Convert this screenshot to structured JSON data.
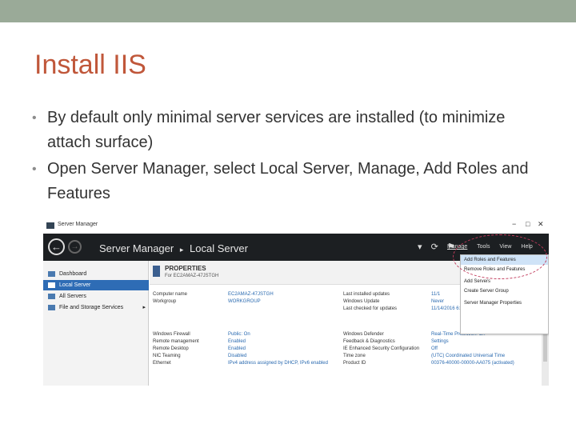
{
  "slide": {
    "title": "Install IIS",
    "bullets": [
      "By default only minimal server services are installed (to minimize attach surface)",
      "Open Server Manager, select Local Server, Manage, Add Roles and Features"
    ],
    "bullet_glyph": "•"
  },
  "screenshot": {
    "window_title": "Server Manager",
    "window_controls": [
      "−",
      "□",
      "✕"
    ],
    "breadcrumb": {
      "root": "Server Manager",
      "separator": "▸",
      "current": "Local Server"
    },
    "menus": [
      "Manage",
      "Tools",
      "View",
      "Help"
    ],
    "sidebar": [
      {
        "label": "Dashboard"
      },
      {
        "label": "Local Server"
      },
      {
        "label": "All Servers"
      },
      {
        "label": "File and Storage Services",
        "chevron": "▸"
      }
    ],
    "properties": {
      "title": "PROPERTIES",
      "subtitle": "For EC2AMAZ-47JSTGH",
      "left_rows": [
        {
          "key": "Computer name",
          "value": "EC2AMAZ-47JSTGH"
        },
        {
          "key": "Workgroup",
          "value": "WORKGROUP"
        },
        {
          "key": "Windows Firewall",
          "value": "Public: On"
        },
        {
          "key": "Remote management",
          "value": "Enabled"
        },
        {
          "key": "Remote Desktop",
          "value": "Enabled"
        },
        {
          "key": "NIC Teaming",
          "value": "Disabled"
        },
        {
          "key": "Ethernet",
          "value": "IPv4 address assigned by DHCP, IPv6 enabled"
        }
      ],
      "right_rows": [
        {
          "key": "Last installed updates",
          "value": "11/1"
        },
        {
          "key": "Windows Update",
          "value": "Never"
        },
        {
          "key": "Last checked for updates",
          "value": "11/14/2016 6:23 PM"
        },
        {
          "key": "Windows Defender",
          "value": "Real-Time Protection: On"
        },
        {
          "key": "Feedback & Diagnostics",
          "value": "Settings"
        },
        {
          "key": "IE Enhanced Security Configuration",
          "value": "Off"
        },
        {
          "key": "Time zone",
          "value": "(UTC) Coordinated Universal Time"
        },
        {
          "key": "Product ID",
          "value": "00376-40000-00000-AA075 (activated)"
        }
      ]
    },
    "manage_menu": [
      "Add Roles and Features",
      "Remove Roles and Features",
      "Add Servers",
      "Create Server Group",
      "Server Manager Properties"
    ],
    "colors": {
      "title": "#c0573a",
      "topbar": "#9aaa98",
      "sm_bar": "#1c1f22",
      "selected_nav": "#2e6cb5",
      "link_value": "#2a6ab0",
      "annotation": "#c0395a"
    },
    "icons": [
      "back-arrow-icon",
      "forward-arrow-icon",
      "refresh-icon",
      "flag-icon",
      "server-icon",
      "dashboard-icon"
    ]
  }
}
